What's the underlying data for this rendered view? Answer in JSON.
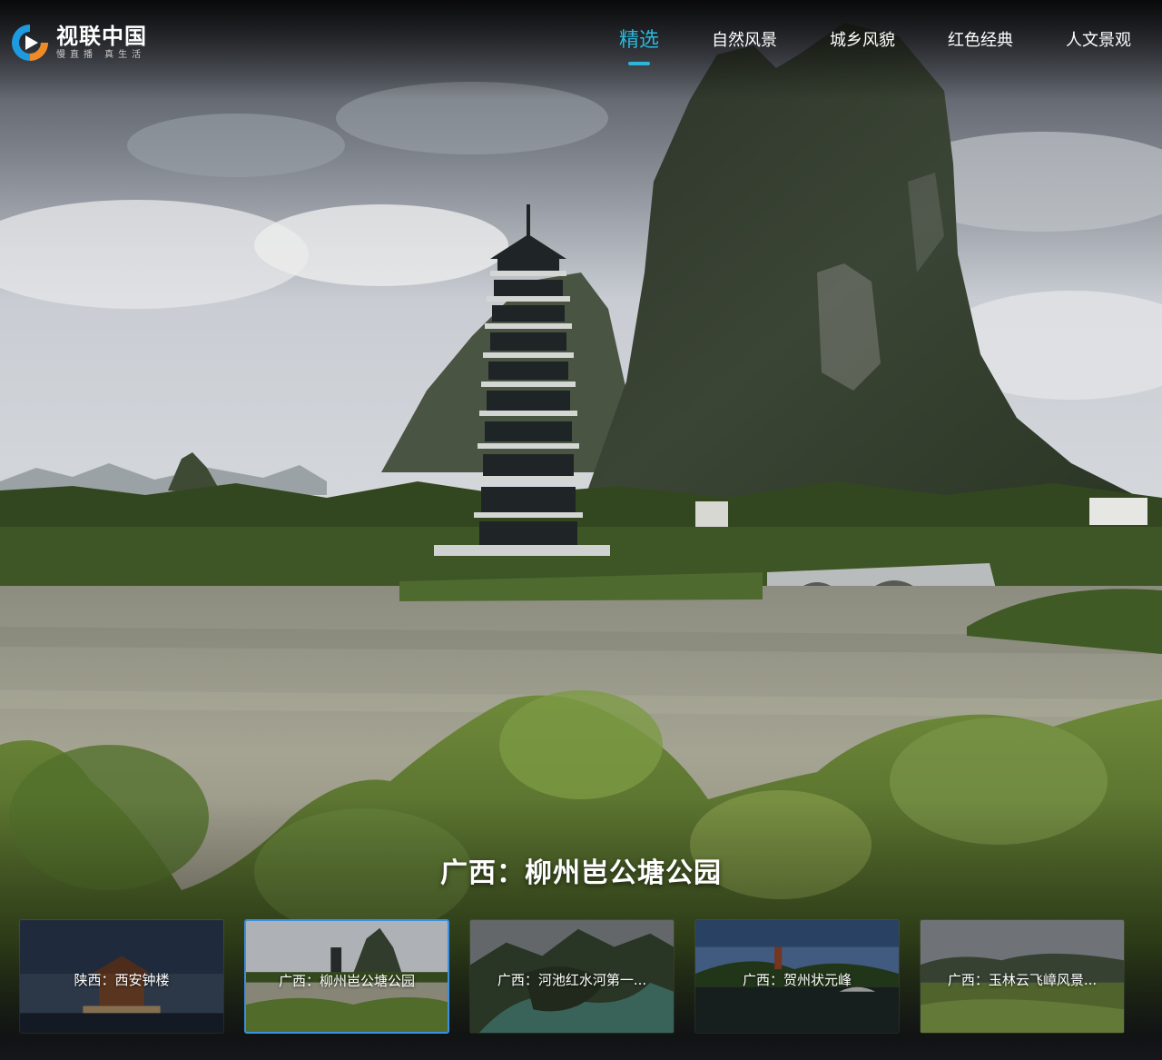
{
  "brand": {
    "name": "视联中国",
    "slogan": "慢直播 真生活",
    "colors": {
      "accent": "#2bb7d8",
      "logo_blue": "#1e9be0",
      "logo_orange": "#f08a24",
      "selected_border": "#3d8fe0"
    }
  },
  "nav": {
    "items": [
      {
        "label": "精选",
        "active": true
      },
      {
        "label": "自然风景",
        "active": false
      },
      {
        "label": "城乡风貌",
        "active": false
      },
      {
        "label": "红色经典",
        "active": false
      },
      {
        "label": "人文景观",
        "active": false
      }
    ]
  },
  "hero": {
    "title": "广西：柳州岜公塘公园"
  },
  "thumbnails": [
    {
      "label": "陕西：西安钟楼",
      "selected": false
    },
    {
      "label": "广西：柳州岜公塘公园",
      "selected": true
    },
    {
      "label": "广西：河池红水河第一...",
      "selected": false
    },
    {
      "label": "广西：贺州状元峰",
      "selected": false
    },
    {
      "label": "广西：玉林云飞嶂风景...",
      "selected": false
    }
  ]
}
